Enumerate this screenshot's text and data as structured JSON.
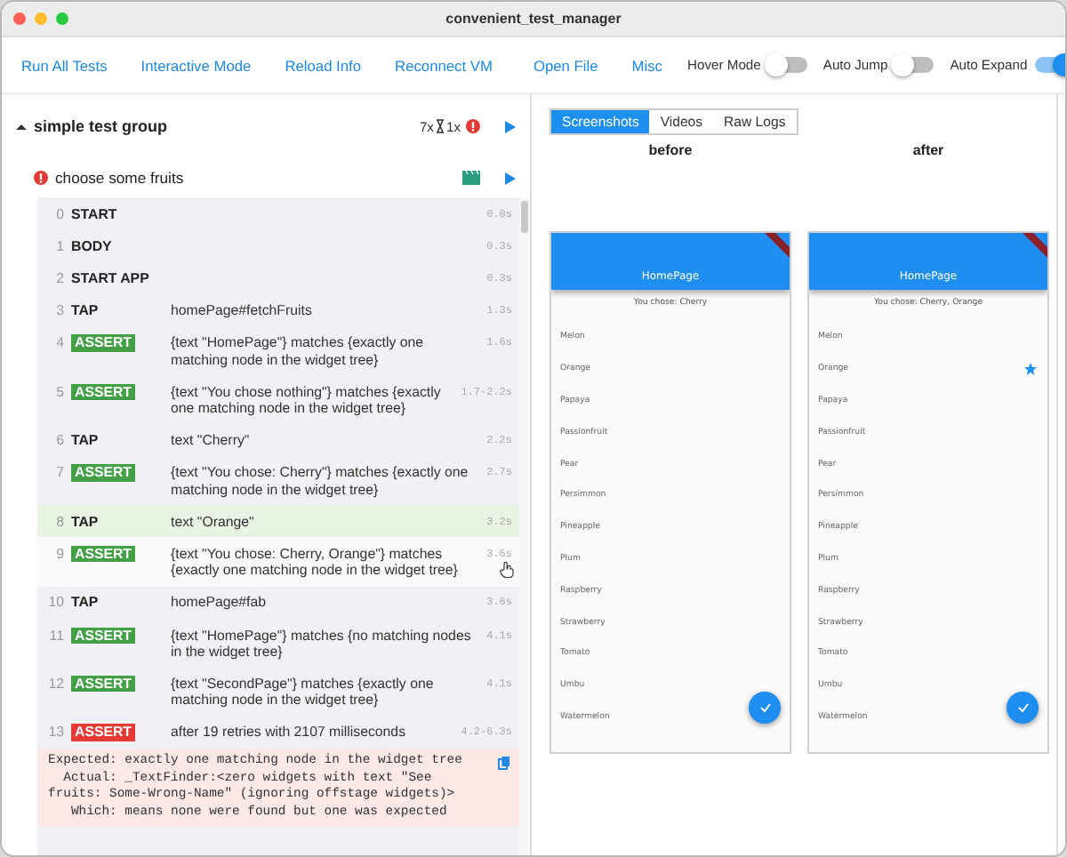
{
  "window": {
    "title": "convenient_test_manager"
  },
  "toolbar": {
    "actions": [
      "Run All Tests",
      "Interactive Mode",
      "Reload Info",
      "Reconnect VM",
      "Open File",
      "Misc"
    ],
    "toggles": [
      {
        "label": "Hover Mode",
        "on": false
      },
      {
        "label": "Auto Jump",
        "on": false
      },
      {
        "label": "Auto Expand",
        "on": true
      }
    ]
  },
  "group": {
    "name": "simple test group",
    "expanded": true,
    "counts": [
      "7x",
      "1x"
    ]
  },
  "test": {
    "name": "choose some fruits",
    "failed": true
  },
  "steps": [
    {
      "index": "0",
      "kind": "plain",
      "command": "START",
      "time": "0.0s",
      "selected": false,
      "hovered": false
    },
    {
      "index": "1",
      "kind": "plain",
      "command": "BODY",
      "time": "0.3s",
      "selected": false,
      "hovered": false
    },
    {
      "index": "2",
      "kind": "plain",
      "command": "START APP",
      "time": "0.3s",
      "selected": false,
      "hovered": false
    },
    {
      "index": "3",
      "kind": "plain",
      "command": "TAP",
      "detail": "homePage#fetchFruits",
      "time": "1.3s",
      "selected": false,
      "hovered": false
    },
    {
      "index": "4",
      "kind": "assert",
      "color": "#43a047",
      "command": "ASSERT",
      "detail": "{text \"HomePage\"} matches {exactly one matching node in the widget tree}",
      "time": "1.6s",
      "selected": false,
      "hovered": false
    },
    {
      "index": "5",
      "kind": "assert",
      "color": "#43a047",
      "command": "ASSERT",
      "detail": "{text \"You chose nothing\"} matches {exactly one matching node in the widget tree}",
      "time": "1.7-2.2s",
      "selected": false,
      "hovered": false
    },
    {
      "index": "6",
      "kind": "plain",
      "command": "TAP",
      "detail": "text \"Cherry\"",
      "time": "2.2s",
      "selected": false,
      "hovered": false
    },
    {
      "index": "7",
      "kind": "assert",
      "color": "#43a047",
      "command": "ASSERT",
      "detail": "{text \"You chose: Cherry\"} matches {exactly one matching node in the widget tree}",
      "time": "2.7s",
      "selected": false,
      "hovered": false
    },
    {
      "index": "8",
      "kind": "plain",
      "command": "TAP",
      "detail": "text \"Orange\"",
      "time": "3.2s",
      "selected": true,
      "hovered": false
    },
    {
      "index": "9",
      "kind": "assert",
      "color": "#43a047",
      "command": "ASSERT",
      "detail": "{text \"You chose: Cherry, Orange\"} matches {exactly one matching node in the widget tree}",
      "time": "3.6s",
      "selected": false,
      "hovered": true
    },
    {
      "index": "10",
      "kind": "plain",
      "command": "TAP",
      "detail": "homePage#fab",
      "time": "3.6s",
      "selected": false,
      "hovered": false
    },
    {
      "index": "11",
      "kind": "assert",
      "color": "#43a047",
      "command": "ASSERT",
      "detail": "{text \"HomePage\"} matches {no matching nodes in the widget tree}",
      "time": "4.1s",
      "selected": false,
      "hovered": false
    },
    {
      "index": "12",
      "kind": "assert",
      "color": "#43a047",
      "command": "ASSERT",
      "detail": "{text \"SecondPage\"} matches {exactly one matching node in the widget tree}",
      "time": "4.1s",
      "selected": false,
      "hovered": false
    },
    {
      "index": "13",
      "kind": "assert",
      "color": "#e53935",
      "command": "ASSERT",
      "detail": "after 19 retries with 2107 milliseconds",
      "time": "4.2-6.3s",
      "selected": false,
      "hovered": false
    }
  ],
  "error": {
    "message": "Expected: exactly one matching node in the widget tree\n  Actual: _TextFinder:<zero widgets with text \"See fruits: Some-Wrong-Name\" (ignoring offstage widgets)>\n   Which: means none were found but one was expected"
  },
  "tabs": [
    {
      "label": "Screenshots",
      "selected": true
    },
    {
      "label": "Videos",
      "selected": false
    },
    {
      "label": "Raw Logs",
      "selected": false
    }
  ],
  "screenshots": [
    {
      "caption": "before",
      "app_title": "HomePage",
      "chosen": "You chose: Cherry",
      "items": [
        {
          "label": "Melon",
          "starred": false
        },
        {
          "label": "Orange",
          "starred": false
        },
        {
          "label": "Papaya",
          "starred": false
        },
        {
          "label": "Passionfruit",
          "starred": false
        },
        {
          "label": "Pear",
          "starred": false
        },
        {
          "label": "Persimmon",
          "starred": false
        },
        {
          "label": "Pineapple",
          "starred": false
        },
        {
          "label": "Plum",
          "starred": false
        },
        {
          "label": "Raspberry",
          "starred": false
        },
        {
          "label": "Strawberry",
          "starred": false
        },
        {
          "label": "Tomato",
          "starred": false
        },
        {
          "label": "Umbu",
          "starred": false
        },
        {
          "label": "Watermelon",
          "starred": false
        }
      ]
    },
    {
      "caption": "after",
      "app_title": "HomePage",
      "chosen": "You chose: Cherry, Orange",
      "items": [
        {
          "label": "Melon",
          "starred": false
        },
        {
          "label": "Orange",
          "starred": true
        },
        {
          "label": "Papaya",
          "starred": false
        },
        {
          "label": "Passionfruit",
          "starred": false
        },
        {
          "label": "Pear",
          "starred": false
        },
        {
          "label": "Persimmon",
          "starred": false
        },
        {
          "label": "Pineapple",
          "starred": false
        },
        {
          "label": "Plum",
          "starred": false
        },
        {
          "label": "Raspberry",
          "starred": false
        },
        {
          "label": "Strawberry",
          "starred": false
        },
        {
          "label": "Tomato",
          "starred": false
        },
        {
          "label": "Umbu",
          "starred": false
        },
        {
          "label": "Watermelon",
          "starred": false
        }
      ]
    }
  ]
}
